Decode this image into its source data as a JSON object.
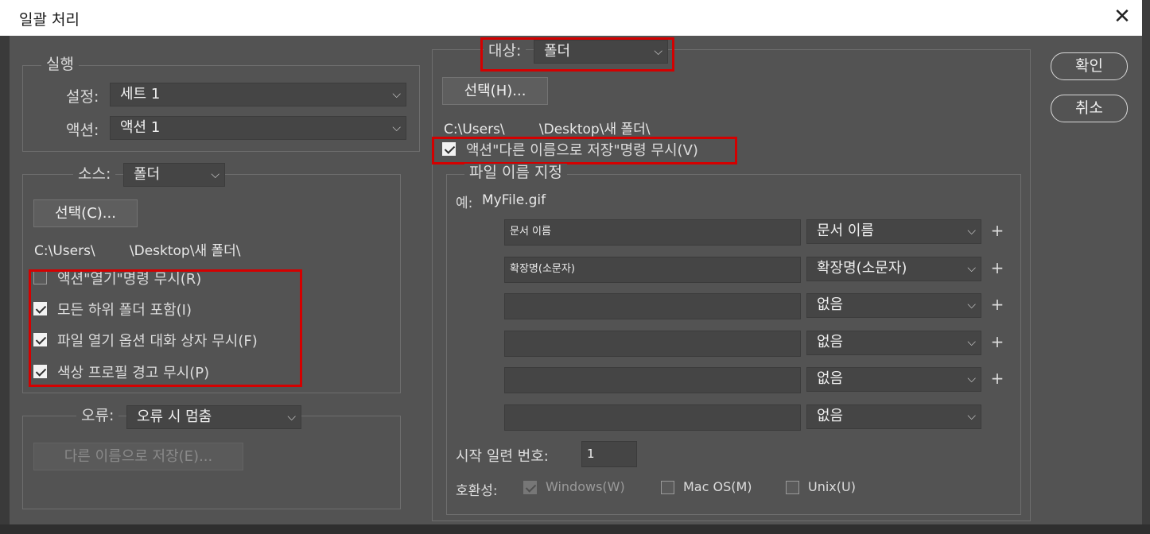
{
  "window": {
    "title": "일괄 처리"
  },
  "play": {
    "legend": "실행",
    "set_label": "설정:",
    "set_value": "세트 1",
    "action_label": "액션:",
    "action_value": "액션 1"
  },
  "source": {
    "legend_label": "소스:",
    "value": "폴더",
    "choose_button": "선택(C)...",
    "path": "C:\\Users\\        \\Desktop\\새 폴더\\",
    "checkboxes": [
      {
        "label": "액션\"열기\"명령 무시(R)",
        "checked": false
      },
      {
        "label": "모든 하위 폴더 포함(I)",
        "checked": true
      },
      {
        "label": "파일 열기 옵션 대화 상자 무시(F)",
        "checked": true
      },
      {
        "label": "색상 프로필 경고 무시(P)",
        "checked": true
      }
    ]
  },
  "errors": {
    "legend_label": "오류:",
    "value": "오류 시 멈춤",
    "save_as_button": "다른 이름으로 저장(E)..."
  },
  "destination": {
    "label": "대상:",
    "value": "폴더",
    "choose_button": "선택(H)...",
    "path": "C:\\Users\\        \\Desktop\\새 폴더\\",
    "override_checkbox": {
      "label": "액션\"다른 이름으로 저장\"명령 무시(V)",
      "checked": true
    }
  },
  "naming": {
    "legend": "파일 이름 지정",
    "example_label": "예:",
    "example_value": "MyFile.gif",
    "rows": [
      {
        "input": "문서 이름",
        "select": "문서 이름",
        "plus": "+"
      },
      {
        "input": "확장명(소문자)",
        "select": "확장명(소문자)",
        "plus": "+"
      },
      {
        "input": "",
        "select": "없음",
        "plus": "+"
      },
      {
        "input": "",
        "select": "없음",
        "plus": "+"
      },
      {
        "input": "",
        "select": "없음",
        "plus": "+"
      },
      {
        "input": "",
        "select": "없음",
        "plus": ""
      }
    ],
    "serial_label": "시작 일련 번호:",
    "serial_value": "1",
    "compat_label": "호환성:",
    "compat": [
      {
        "label": "Windows(W)",
        "checked": true,
        "disabled": true
      },
      {
        "label": "Mac OS(M)",
        "checked": false,
        "disabled": false
      },
      {
        "label": "Unix(U)",
        "checked": false,
        "disabled": false
      }
    ]
  },
  "buttons": {
    "ok": "확인",
    "cancel": "취소"
  },
  "icons": {
    "close": "close-icon",
    "chevron": "chevron-down-icon",
    "check": "checkmark-icon"
  },
  "colors": {
    "highlight": "#d40000",
    "dialog_bg": "#535353"
  }
}
